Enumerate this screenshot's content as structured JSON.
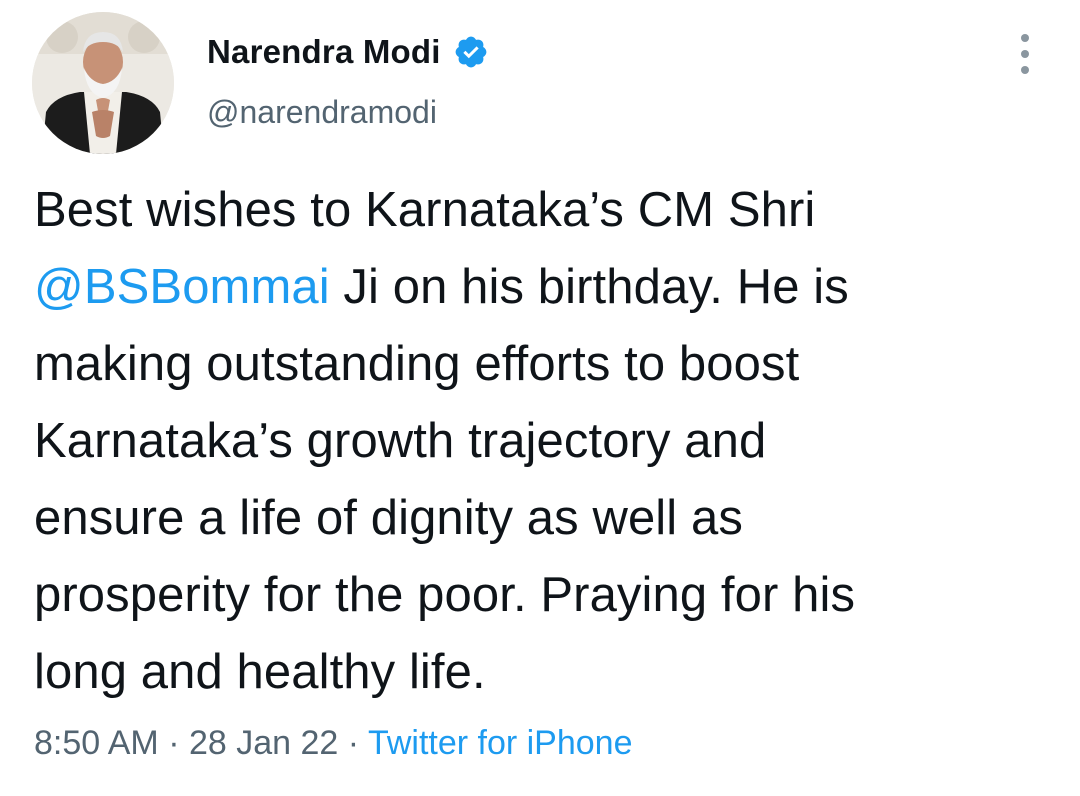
{
  "author": {
    "display_name": "Narendra Modi",
    "handle": "@narendramodi",
    "verified": true
  },
  "tweet": {
    "lines": [
      {
        "text": "Best wishes to Karnataka’s CM Shri"
      },
      {
        "mention": "@BSBommai",
        "text": " Ji on his birthday. He is"
      },
      {
        "text": "making outstanding efforts to boost"
      },
      {
        "text": "Karnataka’s growth trajectory and"
      },
      {
        "text": "ensure a life of dignity as well as"
      },
      {
        "text": "prosperity for the poor. Praying for his"
      },
      {
        "text": "long and healthy life."
      }
    ]
  },
  "meta": {
    "time": "8:50 AM",
    "separator": " · ",
    "date": "28 Jan 22",
    "source": "Twitter for iPhone"
  },
  "icons": {
    "verified": "verified-badge-icon",
    "more": "more-options-icon"
  },
  "colors": {
    "link": "#1d9bf0",
    "secondary_text": "#536471",
    "primary_text": "#0f1419"
  }
}
